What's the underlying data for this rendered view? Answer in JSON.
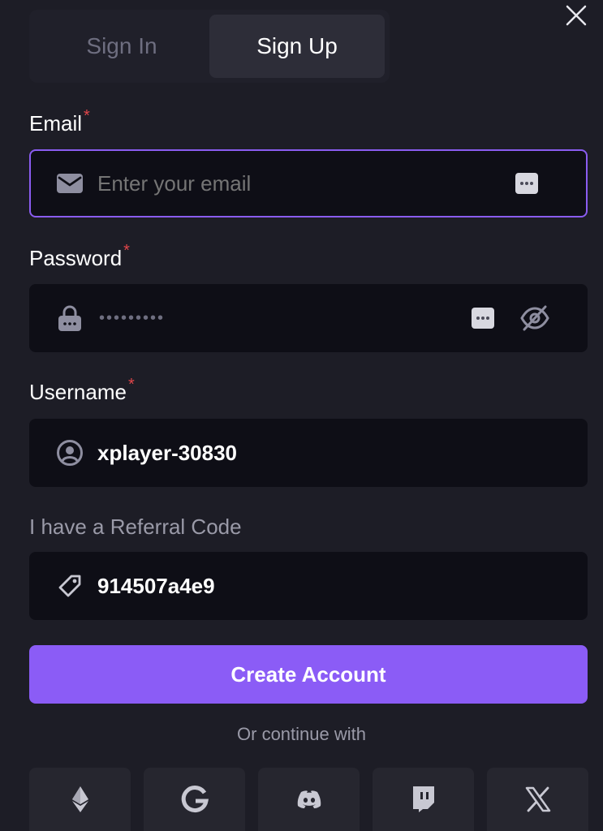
{
  "tabs": [
    {
      "label": "Sign In",
      "active": false
    },
    {
      "label": "Sign Up",
      "active": true
    }
  ],
  "form": {
    "email": {
      "label": "Email",
      "required_mark": "*",
      "placeholder": "Enter your email",
      "value": ""
    },
    "password": {
      "label": "Password",
      "required_mark": "*",
      "masked_value": "•••••••••"
    },
    "username": {
      "label": "Username",
      "required_mark": "*",
      "value": "xplayer-30830"
    },
    "referral": {
      "label": "I have a Referral Code",
      "value": "914507a4e9"
    }
  },
  "actions": {
    "create_account_label": "Create Account",
    "divider_label": "Or continue with"
  },
  "social_providers": [
    "ethereum-icon",
    "google-icon",
    "discord-icon",
    "twitch-icon",
    "x-icon"
  ],
  "icons": {
    "close": "close-icon",
    "email": "mail-icon",
    "password": "lock-icon",
    "username": "user-circle-icon",
    "referral": "tag-icon",
    "autofill": "more-dots-icon",
    "visibility": "eye-off-icon"
  },
  "colors": {
    "background": "#1d1d26",
    "input_background": "#0e0e16",
    "accent": "#8b5cf6",
    "focus_border": "#8a5cf0",
    "required": "#e0464a"
  }
}
